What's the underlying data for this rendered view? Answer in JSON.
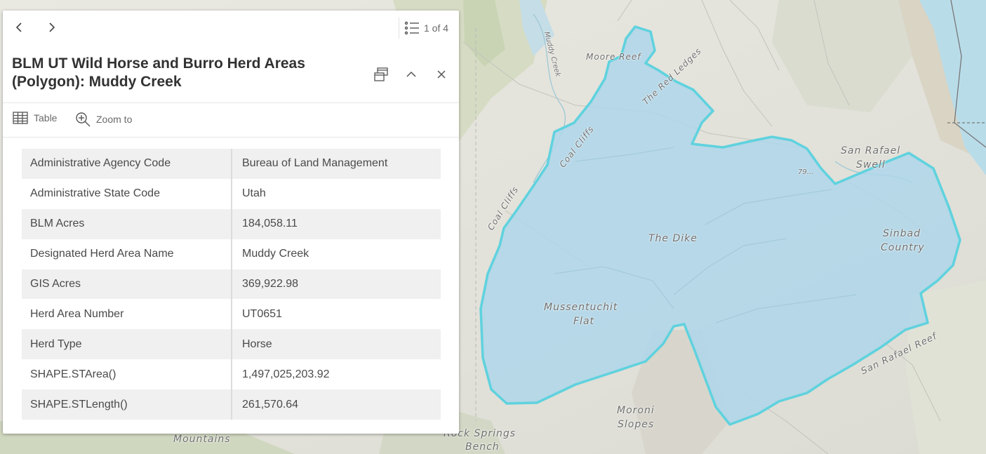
{
  "popup": {
    "title": "BLM UT Wild Horse and Burro Herd Areas (Polygon): Muddy Creek",
    "page_indicator": "1 of 4",
    "actions": {
      "table": "Table",
      "zoom": "Zoom to"
    },
    "attributes": [
      {
        "key": "Administrative Agency Code",
        "value": "Bureau of Land Management"
      },
      {
        "key": "Administrative State Code",
        "value": "Utah"
      },
      {
        "key": "BLM Acres",
        "value": "184,058.11"
      },
      {
        "key": "Designated Herd Area Name",
        "value": "Muddy Creek"
      },
      {
        "key": "GIS Acres",
        "value": "369,922.98"
      },
      {
        "key": "Herd Area Number",
        "value": "UT0651"
      },
      {
        "key": "Herd Type",
        "value": "Horse"
      },
      {
        "key": "SHAPE.STArea()",
        "value": "1,497,025,203.92"
      },
      {
        "key": "SHAPE.STLength()",
        "value": "261,570.64"
      }
    ]
  },
  "map": {
    "labels": {
      "the_dike": "The Dike",
      "sinbad_1": "Sinbad",
      "sinbad_2": "Country",
      "san_rafael_1": "San Rafael",
      "san_rafael_2": "Swell",
      "mussentuchit_1": "Mussentuchit",
      "mussentuchit_2": "Flat",
      "moroni_1": "Moroni",
      "moroni_2": "Slopes",
      "rock_springs_1": "Rock Springs",
      "rock_springs_2": "Bench",
      "mountains": "Mountains",
      "coal_cliffs_1": "Coal Cliffs",
      "coal_cliffs_2": "Coal Cliffs",
      "red_ledges": "The Red Ledges",
      "san_rafael_reef": "San Rafael Reef",
      "muddy_creek": "Muddy Creek",
      "moore_reef": "Moore Reef",
      "route": "79..."
    },
    "colors": {
      "herd_fill": "#aed6ea",
      "herd_outline": "#5fd2de",
      "popup_bg": "#ffffff"
    }
  }
}
